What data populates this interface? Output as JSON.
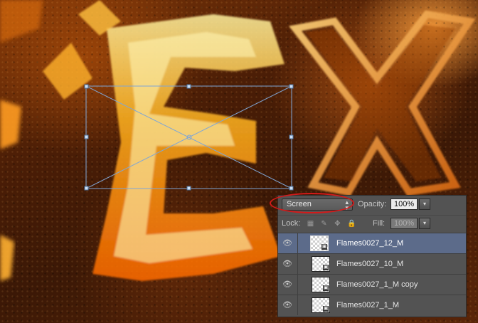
{
  "canvas": {
    "description_icon": "fire-text-artwork"
  },
  "layers_panel": {
    "blend_mode": "Screen",
    "opacity_label": "Opacity:",
    "opacity_value": "100%",
    "lock_label": "Lock:",
    "fill_label": "Fill:",
    "fill_value": "100%",
    "layers": [
      {
        "name": "Flames0027_12_M",
        "selected": true
      },
      {
        "name": "Flames0027_10_M",
        "selected": false
      },
      {
        "name": "Flames0027_1_M copy",
        "selected": false
      },
      {
        "name": "Flames0027_1_M",
        "selected": false
      }
    ]
  },
  "colors": {
    "selection_highlight": "#5c6b8a",
    "annotation_ring": "#d21a1a",
    "transform_box": "#7fa6d6"
  }
}
